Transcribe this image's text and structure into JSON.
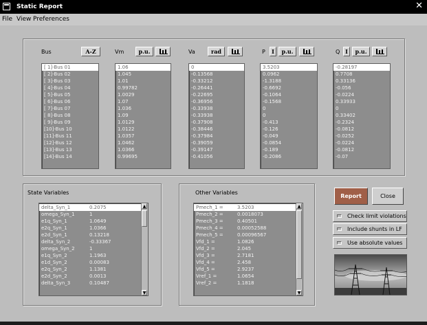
{
  "window": {
    "title": "Static Report",
    "close_glyph": "✕"
  },
  "menu": {
    "file": "File",
    "view": "View",
    "preferences": "Preferences"
  },
  "bus_panel": {
    "bus_label": "Bus",
    "sort_button": "A-Z",
    "vm_label": "Vm",
    "va_label": "Va",
    "p_label": "P",
    "q_label": "Q",
    "pu_button": "p.u.",
    "rad_button": "rad",
    "info_button": "I",
    "buses": [
      "[ 1]-Bus 01",
      "[ 2]-Bus 02",
      "[ 3]-Bus 03",
      "[ 4]-Bus 04",
      "[ 5]-Bus 05",
      "[ 6]-Bus 06",
      "[ 7]-Bus 07",
      "[ 8]-Bus 08",
      "[ 9]-Bus 09",
      "[10]-Bus 10",
      "[11]-Bus 11",
      "[12]-Bus 12",
      "[13]-Bus 13",
      "[14]-Bus 14"
    ],
    "vm": [
      "1.06",
      "1.045",
      "1.01",
      "0.99782",
      "1.0029",
      "1.07",
      "1.036",
      "1.09",
      "1.0129",
      "1.0122",
      "1.0357",
      "1.0462",
      "1.0366",
      "0.99695"
    ],
    "va": [
      "0",
      "-0.13568",
      "-0.33212",
      "-0.26441",
      "-0.22695",
      "-0.36956",
      "-0.33938",
      "-0.33938",
      "-0.37908",
      "-0.38446",
      "-0.37984",
      "-0.39059",
      "-0.39147",
      "-0.41056"
    ],
    "p": [
      "3.5203",
      "0.0962",
      "-1.3188",
      "-0.6692",
      "-0.1064",
      "-0.1568",
      "0",
      "0",
      "-0.413",
      "-0.126",
      "-0.049",
      "-0.0854",
      "-0.189",
      "-0.2086"
    ],
    "q": [
      "-0.28197",
      "0.7708",
      "0.33136",
      "-0.056",
      "-0.0224",
      "0.33933",
      "0",
      "0.33402",
      "-0.2324",
      "-0.0812",
      "-0.0252",
      "-0.0224",
      "-0.0812",
      "-0.07"
    ]
  },
  "state_panel": {
    "title": "State Variables",
    "rows": [
      {
        "name": "delta_Syn_1",
        "value": "0.2075"
      },
      {
        "name": "omega_Syn_1",
        "value": "1"
      },
      {
        "name": "e1q_Syn_1",
        "value": "1.0649"
      },
      {
        "name": "e2q_Syn_1",
        "value": "1.0366"
      },
      {
        "name": "e2d_Syn_1",
        "value": "0.13218"
      },
      {
        "name": "delta_Syn_2",
        "value": "-0.33367"
      },
      {
        "name": "omega_Syn_2",
        "value": "1"
      },
      {
        "name": "e1q_Syn_2",
        "value": "1.1963"
      },
      {
        "name": "e1d_Syn_2",
        "value": "0.00083"
      },
      {
        "name": "e2q_Syn_2",
        "value": "1.1381"
      },
      {
        "name": "e2d_Syn_2",
        "value": "0.0013"
      },
      {
        "name": "delta_Syn_3",
        "value": "0.10487"
      }
    ]
  },
  "other_panel": {
    "title": "Other Variables",
    "rows": [
      {
        "name": "Pmech_1 =",
        "value": "3.5203"
      },
      {
        "name": "Pmech_2 =",
        "value": "0.0018073"
      },
      {
        "name": "Pmech_3 =",
        "value": "0.40501"
      },
      {
        "name": "Pmech_4 =",
        "value": "0.00052588"
      },
      {
        "name": "Pmech_5 =",
        "value": "0.00096567"
      },
      {
        "name": "Vfd_1 =",
        "value": "1.0826"
      },
      {
        "name": "Vfd_2 =",
        "value": "2.045"
      },
      {
        "name": "Vfd_3 =",
        "value": "2.7181"
      },
      {
        "name": "Vfd_4 =",
        "value": "2.458"
      },
      {
        "name": "Vfd_5 =",
        "value": "2.9237"
      },
      {
        "name": "Vref_1 =",
        "value": "1.0654"
      },
      {
        "name": "Vref_2 =",
        "value": "1.1818"
      }
    ]
  },
  "actions": {
    "report": "Report",
    "close": "Close",
    "check_limits": "Check limit violations",
    "include_shunts": "Include shunts in LF",
    "use_absolute": "Use absolute values"
  },
  "colors": {
    "report_button": "#a05f48",
    "list_bg": "#8d8d8d",
    "title_bg": "#000000"
  },
  "icons": [
    "window-menu-icon",
    "close-icon",
    "bar-chart-icon",
    "scroll-up-icon",
    "scroll-down-icon",
    "checkbox-icon",
    "power-lines-image"
  ]
}
